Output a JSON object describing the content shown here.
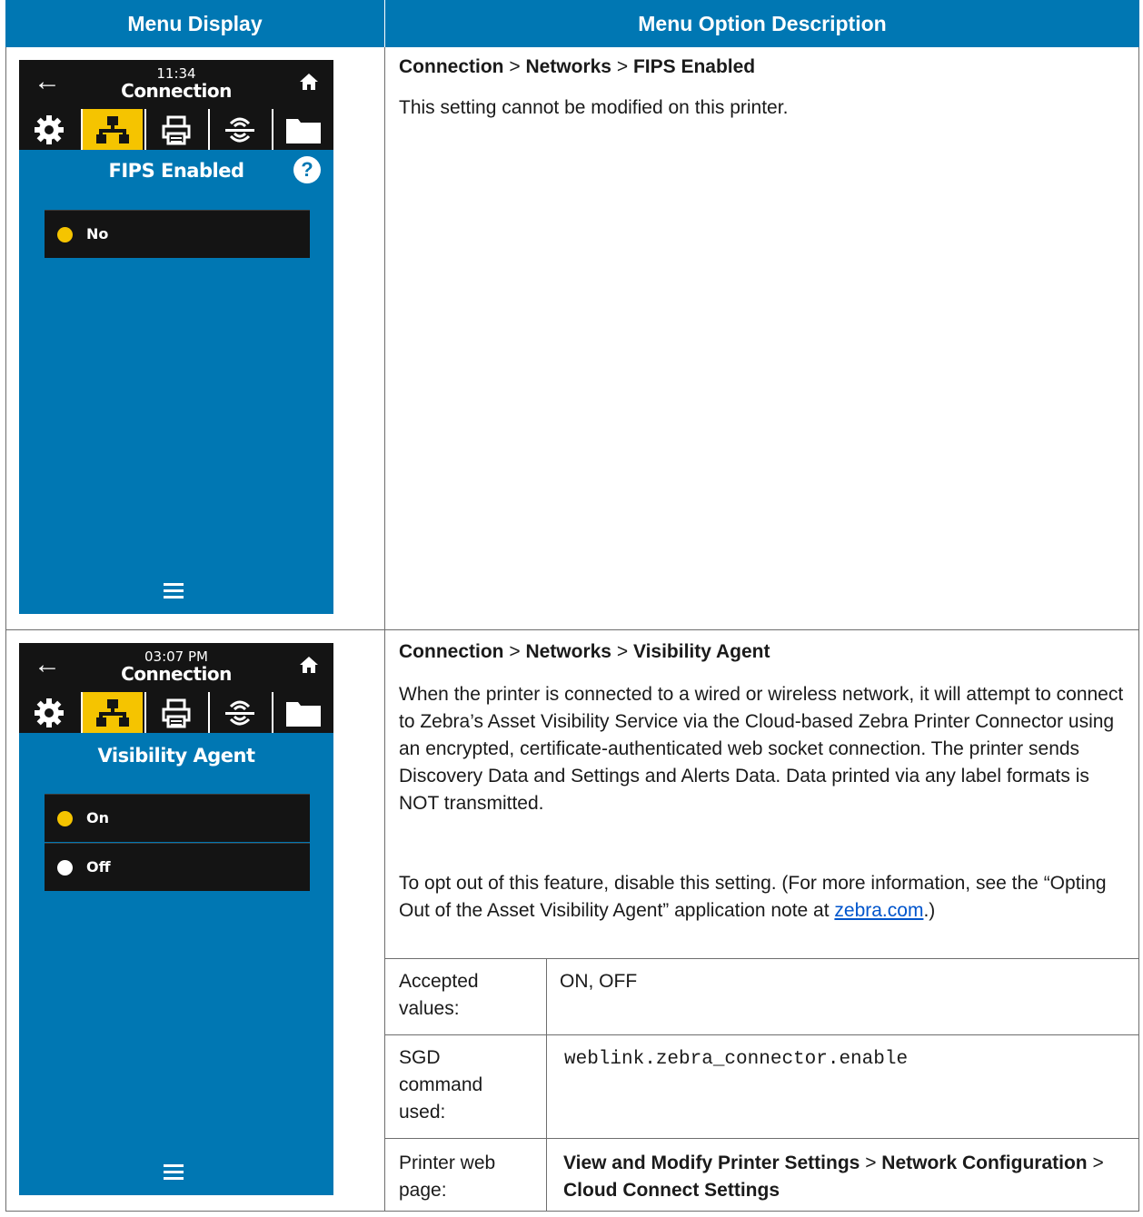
{
  "header": {
    "col1": "Menu Display",
    "col2": "Menu Option Description"
  },
  "colors": {
    "header": "#0077b3",
    "screen_bg": "#0077b3",
    "selected_tab": "#f5c400",
    "radio_selected": "#f5c400",
    "radio_unselected": "#ffffff"
  },
  "row1": {
    "screen": {
      "time": "11:34",
      "title": "Connection",
      "setting": "FIPS Enabled",
      "options": [
        {
          "label": "No",
          "selected": true
        }
      ]
    },
    "path": [
      "Connection",
      "Networks",
      "FIPS Enabled"
    ],
    "description": "This setting cannot be modified on this printer."
  },
  "row2": {
    "screen": {
      "time": "03:07 PM",
      "title": "Connection",
      "setting": "Visibility Agent",
      "options": [
        {
          "label": "On",
          "selected": true
        },
        {
          "label": "Off",
          "selected": false
        }
      ]
    },
    "path": [
      "Connection",
      "Networks",
      "Visibility Agent"
    ],
    "description": "When the printer is connected to a wired or wireless network, it will attempt to connect to Zebra’s Asset Visibility Service via the Cloud-based Zebra Printer Connector using an encrypted, certificate-authenticated web socket connection. The printer sends Discovery Data and Settings and Alerts Data. Data printed via any label formats is NOT transmitted.",
    "optout_text": "To opt out of this feature, disable this setting. (For more information, see the “Opting Out of the Asset Visibility Agent” application note at ",
    "optout_link": "zebra.com",
    "optout_end": ".)",
    "details": [
      {
        "label": "Accepted values:",
        "value": "ON, OFF"
      },
      {
        "label": "SGD command used:",
        "value": "weblink.zebra_connector.enable"
      },
      {
        "label": "Printer web page:",
        "value_parts": [
          "View and Modify Printer Settings",
          "Network Configuration",
          "Cloud Connect Settings"
        ]
      }
    ]
  },
  "separator": ">"
}
